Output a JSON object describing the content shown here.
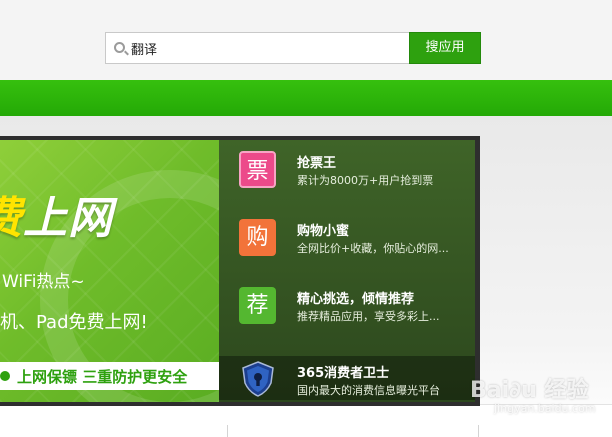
{
  "search": {
    "value": "翻译",
    "button_label": "搜应用"
  },
  "promo": {
    "title_highlight": "费",
    "title_rest": "上网",
    "subtitle_1": "WiFi热点~",
    "subtitle_2": "机、Pad免费上网!",
    "strip_text": "上网保镖  三重防护更安全"
  },
  "apps": [
    {
      "icon_glyph": "票",
      "name": "抢票王",
      "desc": "累计为8000万+用户抢到票"
    },
    {
      "icon_glyph": "购",
      "name": "购物小蜜",
      "desc": "全网比价+收藏，你贴心的网..."
    },
    {
      "icon_glyph": "荐",
      "name": "精心挑选，倾情推荐",
      "desc": "推荐精品应用，享受多彩上..."
    },
    {
      "icon_glyph": "",
      "name": "365消费者卫士",
      "desc": "国内最大的消费信息曝光平台"
    }
  ],
  "watermark": {
    "main": "Bai∂u 经验",
    "sub": "jingyan.baidu.com"
  },
  "colors": {
    "brand_green": "#2ea10f",
    "nav_green": "#2bb009",
    "highlight_yellow": "#ffe400"
  }
}
